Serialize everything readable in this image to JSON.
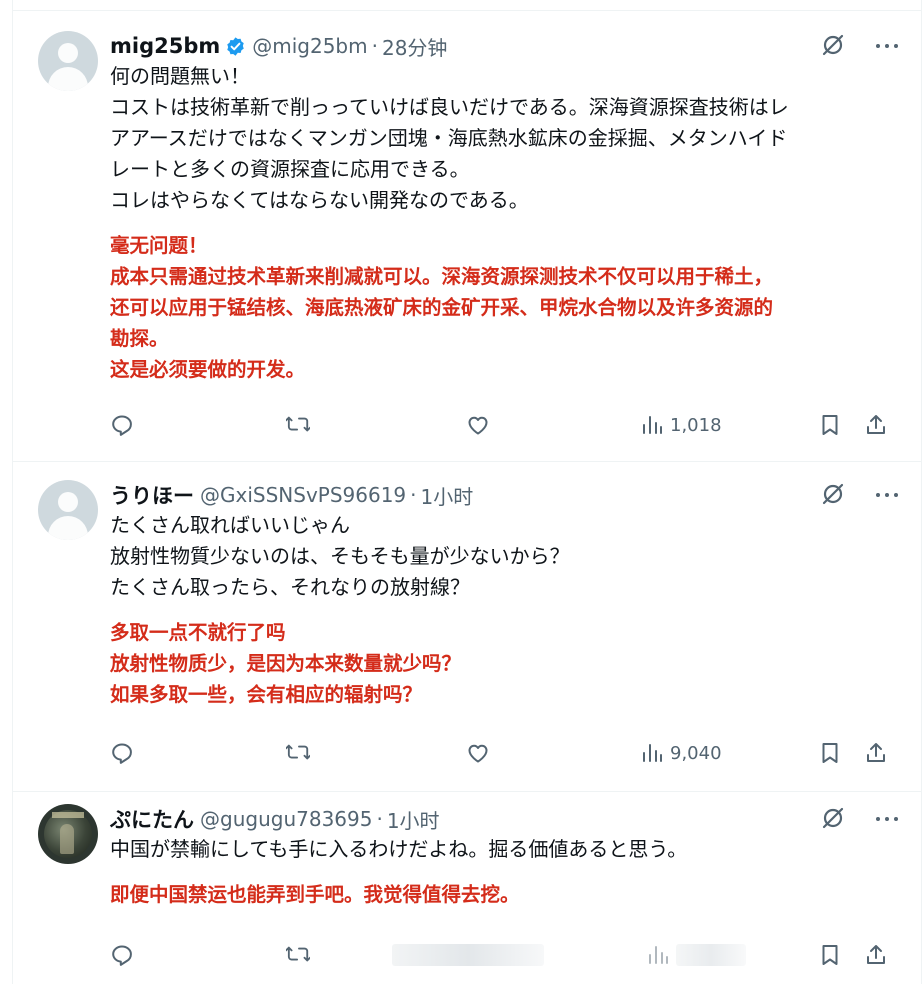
{
  "tweets": [
    {
      "display_name": "mig25bm",
      "verified": true,
      "handle": "@mig25bm",
      "separator": "·",
      "time": "28分钟",
      "text_ja": [
        "何の問題無い！",
        "コストは技術革新で削っっていけば良いだけである。深海資源探査技術はレ",
        "アアースだけではなくマンガン団塊・海底熱水鉱床の金採掘、メタンハイド",
        "レートと多くの資源探査に応用できる。",
        "コレはやらなくてはならない開発なのである。"
      ],
      "text_zh": [
        "毫无问题！",
        "成本只需通过技术革新来削减就可以。深海资源探测技术不仅可以用于稀土，",
        "还可以应用于锰结核、海底热液矿床的金矿开采、甲烷水合物以及许多资源的",
        "勘探。",
        "这是必须要做的开发。"
      ],
      "views": "1,018"
    },
    {
      "display_name": "うりほー",
      "verified": false,
      "handle": "@GxiSSNSvPS96619",
      "separator": "·",
      "time": "1小时",
      "text_ja": [
        "たくさん取ればいいじゃん",
        "放射性物質少ないのは、そもそも量が少ないから？",
        "たくさん取ったら、それなりの放射線？"
      ],
      "text_zh": [
        "多取一点不就行了吗",
        "放射性物质少，是因为本来数量就少吗？",
        "如果多取一些，会有相应的辐射吗？"
      ],
      "views": "9,040"
    },
    {
      "display_name": "ぷにたん",
      "verified": false,
      "handle": "@gugugu783695",
      "separator": "·",
      "time": "1小时",
      "text_ja": [
        "中国が禁輸にしても手に入るわけだよね。掘る価値あると思う。"
      ],
      "text_zh": [
        "即便中国禁运也能弄到手吧。我觉得值得去挖。"
      ],
      "views": ""
    }
  ],
  "icons": {
    "reply": "reply-icon",
    "retweet": "retweet-icon",
    "like": "heart-icon",
    "views": "views-icon",
    "bookmark": "bookmark-icon",
    "share": "share-icon",
    "grok": "grok-icon",
    "more": "more-icon",
    "verified": "verified-badge-icon"
  },
  "colors": {
    "translation_text": "#d42c1a",
    "secondary_text": "#536471",
    "verified_blue": "#1d9bf0",
    "divider": "#eff3f4"
  }
}
